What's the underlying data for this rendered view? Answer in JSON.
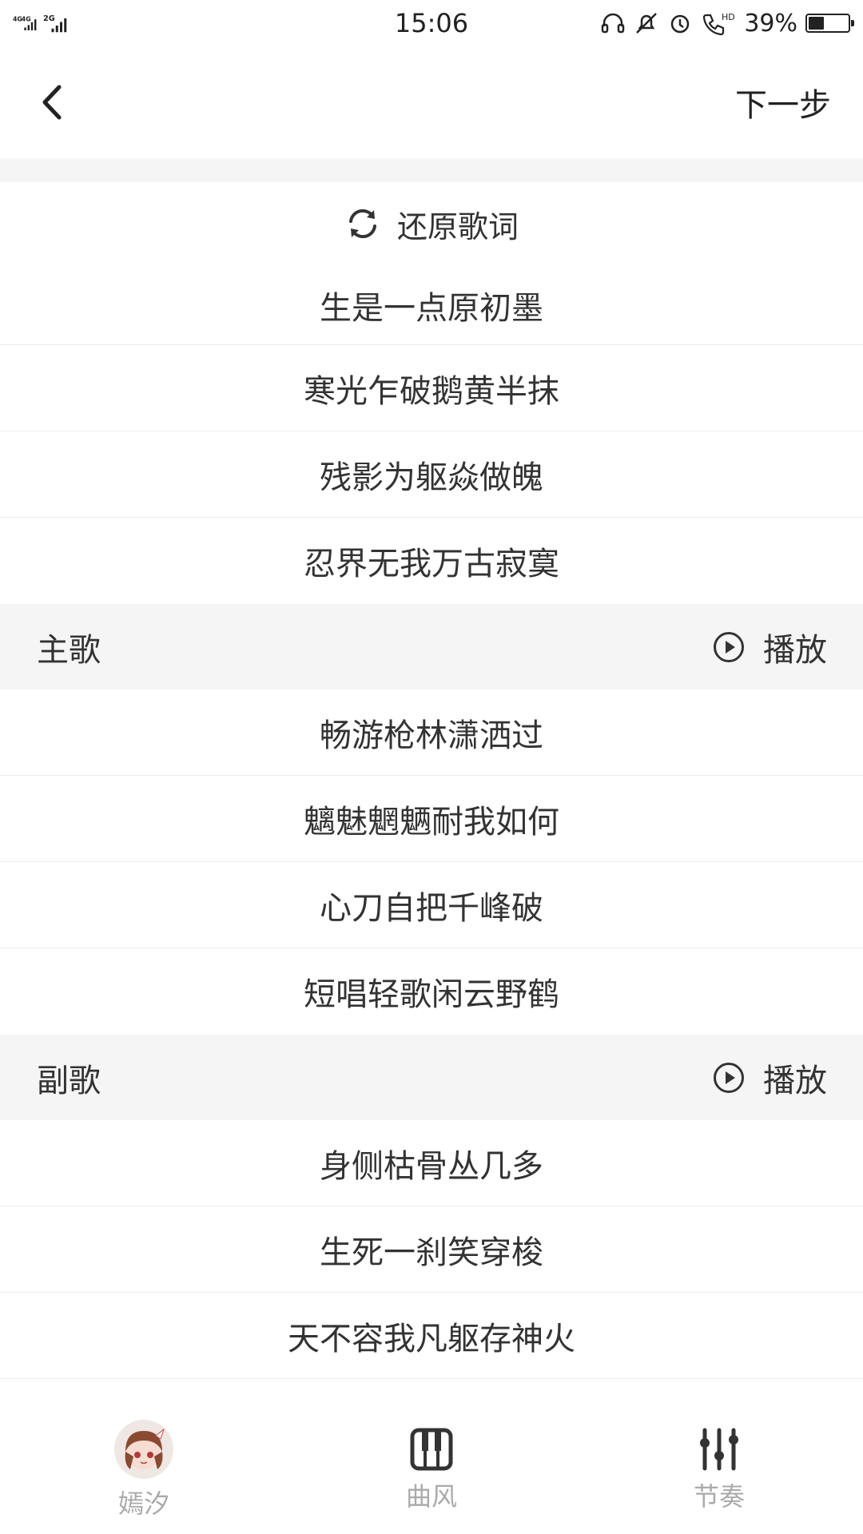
{
  "status_bar": {
    "network_left": "4G",
    "network_mid": "4G",
    "network_right": "2G",
    "time": "15:06",
    "hd": "HD",
    "battery_percent": "39%",
    "battery_level": 0.39
  },
  "header": {
    "next_label": "下一步"
  },
  "restore_label": "还原歌词",
  "lyrics_intro": [
    "生是一点原初墨",
    "寒光乍破鹅黄半抹",
    "残影为躯焱做魄",
    "忍界无我万古寂寞"
  ],
  "verse": {
    "title": "主歌",
    "play_label": "播放",
    "lines": [
      "畅游枪林潇洒过",
      "魑魅魍魉耐我如何",
      "心刀自把千峰破",
      "短唱轻歌闲云野鹤"
    ]
  },
  "chorus": {
    "title": "副歌",
    "play_label": "播放",
    "lines": [
      "身侧枯骨丛几多",
      "生死一刹笑穿梭",
      "天不容我凡躯存神火"
    ]
  },
  "tabs": [
    {
      "label": "嫣汐",
      "icon": "avatar-icon"
    },
    {
      "label": "曲风",
      "icon": "piano-icon"
    },
    {
      "label": "节奏",
      "icon": "sliders-icon"
    }
  ]
}
